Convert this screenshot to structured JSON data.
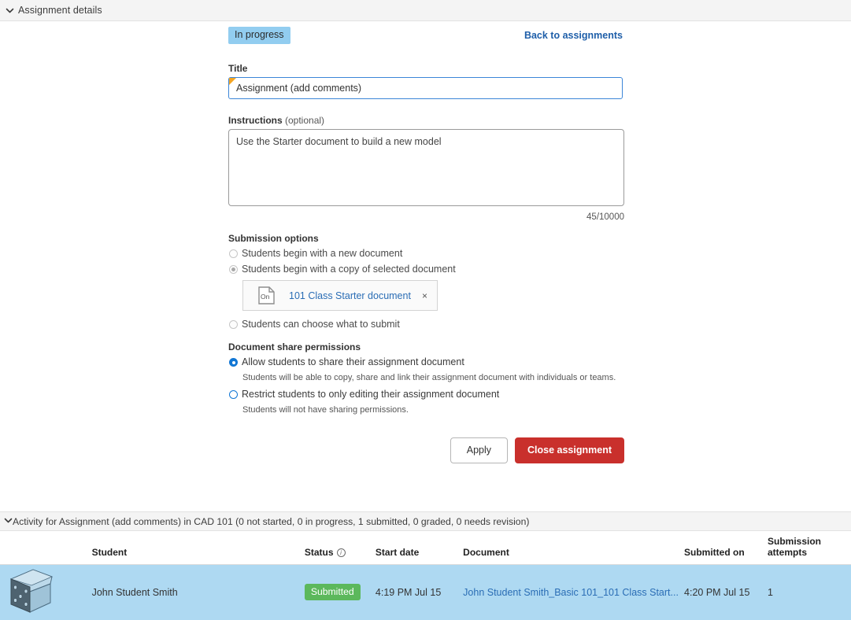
{
  "panel": {
    "header_title": "Assignment details",
    "collapse_icon": "chevron-down-icon"
  },
  "status": {
    "badge_label": "In progress",
    "badge_color": "#92cdf0"
  },
  "nav": {
    "back_link": "Back to assignments"
  },
  "form": {
    "title_label": "Title",
    "title_value": "Assignment (add comments)",
    "instructions_label": "Instructions",
    "instructions_optional": " (optional)",
    "instructions_value": "Use the Starter document to build a new model",
    "char_count": "45/10000"
  },
  "submission_options": {
    "heading": "Submission options",
    "options": [
      {
        "label": "Students begin with a new document",
        "selected": false,
        "disabled": true
      },
      {
        "label": "Students begin with a copy of selected document",
        "selected": true,
        "disabled": true
      },
      {
        "label": "Students can choose what to submit",
        "selected": false,
        "disabled": true
      }
    ],
    "selected_document": {
      "icon": "onshape-document-icon",
      "icon_text": "On",
      "name": "101 Class Starter document",
      "remove_label": "×"
    }
  },
  "share_permissions": {
    "heading": "Document share permissions",
    "options": [
      {
        "label": "Allow students to share their assignment document",
        "description": "Students will be able to copy, share and link their assignment document with individuals or teams.",
        "selected": true
      },
      {
        "label": "Restrict students to only editing their assignment document",
        "description": "Students will not have sharing permissions.",
        "selected": false
      }
    ]
  },
  "buttons": {
    "apply_label": "Apply",
    "close_label": "Close assignment",
    "close_color": "#c9302c"
  },
  "activity": {
    "header": "Activity for Assignment (add comments) in CAD 101 (0 not started, 0 in progress, 1 submitted, 0 graded, 0 needs revision)",
    "collapse_icon": "chevron-down-icon",
    "columns": {
      "thumbnail": "",
      "student": "Student",
      "status": "Status",
      "start_date": "Start date",
      "document": "Document",
      "submitted_on": "Submitted on",
      "attempts_line1": "Submission",
      "attempts_line2": "attempts"
    },
    "rows": [
      {
        "thumbnail": "cad-part-thumbnail",
        "student": "John Student Smith",
        "status": "Submitted",
        "status_color": "#5cb85c",
        "start_date": "4:19 PM Jul 15",
        "document": "John Student Smith_Basic 101_101 Class Start...",
        "submitted_on": "4:20 PM Jul 15",
        "attempts": "1",
        "row_color": "#aed9f2"
      }
    ]
  }
}
